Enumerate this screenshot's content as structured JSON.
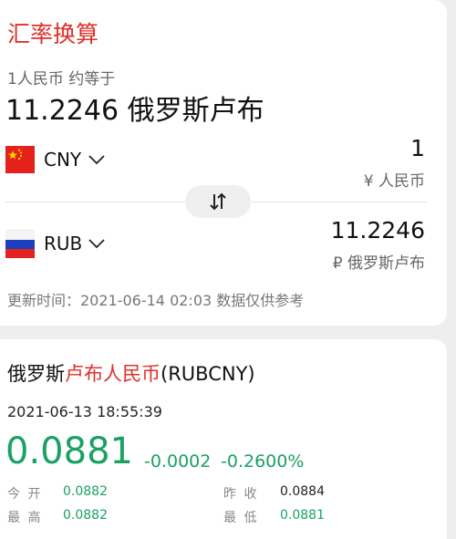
{
  "converter": {
    "title": "汇率换算",
    "subtitle": "1人民币 约等于",
    "rate_text": "11.2246 俄罗斯卢布",
    "from": {
      "code": "CNY",
      "amount": "1",
      "currency_name": "¥ 人民币",
      "flag": "china-flag-icon"
    },
    "to": {
      "code": "RUB",
      "amount": "11.2246",
      "currency_name": "₽ 俄罗斯卢布",
      "flag": "russia-flag-icon"
    },
    "updated": "更新时间：2021-06-14 02:03 数据仅供参考",
    "swap_icon": "swap-arrows-icon"
  },
  "quote": {
    "title_prefix": "俄罗斯",
    "title_highlight": "卢布人民币",
    "title_suffix": "(RUBCNY)",
    "datetime": "2021-06-13 18:55:39",
    "price": "0.0881",
    "change": "-0.0002",
    "change_pct": "-0.2600%",
    "open_label": "今 开",
    "open": "0.0882",
    "prev_close_label": "昨 收",
    "prev_close": "0.0884",
    "high_label": "最 高",
    "high": "0.0882",
    "low_label": "最 低",
    "low": "0.0881"
  },
  "colors": {
    "accent_red": "#e0302a",
    "down_green": "#1aa163"
  }
}
